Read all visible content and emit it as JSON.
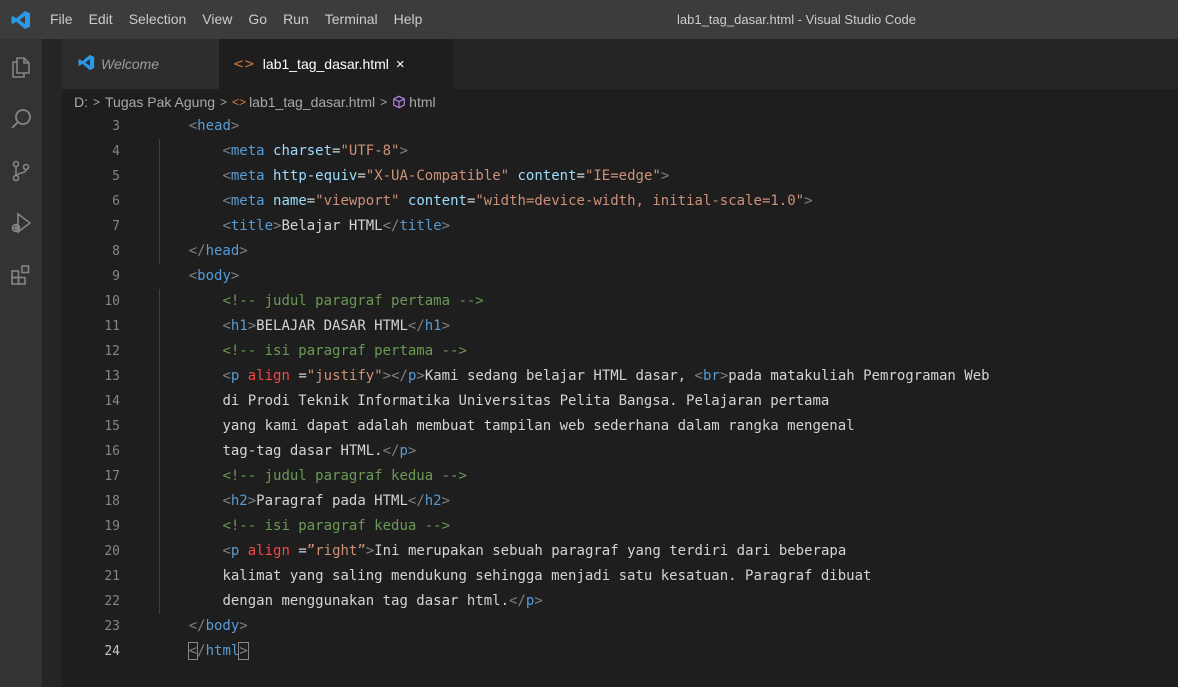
{
  "titlebar": {
    "menu": [
      "File",
      "Edit",
      "Selection",
      "View",
      "Go",
      "Run",
      "Terminal",
      "Help"
    ],
    "window_title": "lab1_tag_dasar.html - Visual Studio Code"
  },
  "activity": [
    "explorer-icon",
    "search-icon",
    "source-control-icon",
    "run-debug-icon",
    "extensions-icon"
  ],
  "tabs": [
    {
      "label": "Welcome",
      "icon": "vscode-icon",
      "active": false
    },
    {
      "label": "lab1_tag_dasar.html",
      "icon": "html-icon",
      "active": true,
      "close": "×"
    }
  ],
  "breadcrumb": {
    "drive": "D:",
    "folder": "Tugas Pak Agung",
    "file": "lab1_tag_dasar.html",
    "symbol": "html",
    "sep": ">"
  },
  "editor": {
    "current_line": 24,
    "lines": [
      {
        "num": "3",
        "tokens": [
          [
            "i",
            "    "
          ],
          [
            "br",
            "<"
          ],
          [
            "tag",
            "head"
          ],
          [
            "br",
            ">"
          ]
        ]
      },
      {
        "num": "4",
        "tokens": [
          [
            "i",
            "        "
          ],
          [
            "br",
            "<"
          ],
          [
            "tag",
            "meta"
          ],
          [
            "txt",
            " "
          ],
          [
            "attr",
            "charset"
          ],
          [
            "op",
            "="
          ],
          [
            "str",
            "\"UTF-8\""
          ],
          [
            "br",
            ">"
          ]
        ]
      },
      {
        "num": "5",
        "tokens": [
          [
            "i",
            "        "
          ],
          [
            "br",
            "<"
          ],
          [
            "tag",
            "meta"
          ],
          [
            "txt",
            " "
          ],
          [
            "attr",
            "http-equiv"
          ],
          [
            "op",
            "="
          ],
          [
            "str",
            "\"X-UA-Compatible\""
          ],
          [
            "txt",
            " "
          ],
          [
            "attr",
            "content"
          ],
          [
            "op",
            "="
          ],
          [
            "str",
            "\"IE=edge\""
          ],
          [
            "br",
            ">"
          ]
        ]
      },
      {
        "num": "6",
        "tokens": [
          [
            "i",
            "        "
          ],
          [
            "br",
            "<"
          ],
          [
            "tag",
            "meta"
          ],
          [
            "txt",
            " "
          ],
          [
            "attr",
            "name"
          ],
          [
            "op",
            "="
          ],
          [
            "str",
            "\"viewport\""
          ],
          [
            "txt",
            " "
          ],
          [
            "attr",
            "content"
          ],
          [
            "op",
            "="
          ],
          [
            "str",
            "\"width=device-width, initial-scale=1.0\""
          ],
          [
            "br",
            ">"
          ]
        ]
      },
      {
        "num": "7",
        "tokens": [
          [
            "i",
            "        "
          ],
          [
            "br",
            "<"
          ],
          [
            "tag",
            "title"
          ],
          [
            "br",
            ">"
          ],
          [
            "txt",
            "Belajar HTML"
          ],
          [
            "br",
            "</"
          ],
          [
            "tag",
            "title"
          ],
          [
            "br",
            ">"
          ]
        ]
      },
      {
        "num": "8",
        "tokens": [
          [
            "i",
            "    "
          ],
          [
            "br",
            "</"
          ],
          [
            "tag",
            "head"
          ],
          [
            "br",
            ">"
          ]
        ]
      },
      {
        "num": "9",
        "tokens": [
          [
            "i",
            "    "
          ],
          [
            "br",
            "<"
          ],
          [
            "tag",
            "body"
          ],
          [
            "br",
            ">"
          ]
        ]
      },
      {
        "num": "10",
        "tokens": [
          [
            "i",
            "        "
          ],
          [
            "com",
            "<!-- judul paragraf pertama -->"
          ]
        ]
      },
      {
        "num": "11",
        "tokens": [
          [
            "i",
            "        "
          ],
          [
            "br",
            "<"
          ],
          [
            "tag",
            "h1"
          ],
          [
            "br",
            ">"
          ],
          [
            "txt",
            "BELAJAR DASAR HTML"
          ],
          [
            "br",
            "</"
          ],
          [
            "tag",
            "h1"
          ],
          [
            "br",
            ">"
          ]
        ]
      },
      {
        "num": "12",
        "tokens": [
          [
            "i",
            "        "
          ],
          [
            "com",
            "<!-- isi paragraf pertama -->"
          ]
        ]
      },
      {
        "num": "13",
        "tokens": [
          [
            "i",
            "        "
          ],
          [
            "br",
            "<"
          ],
          [
            "tag",
            "p"
          ],
          [
            "txt",
            " "
          ],
          [
            "attrred",
            "align"
          ],
          [
            "txt",
            " "
          ],
          [
            "op",
            "="
          ],
          [
            "str",
            "\"justify\""
          ],
          [
            "br",
            ">"
          ],
          [
            "br",
            "</"
          ],
          [
            "tag",
            "p"
          ],
          [
            "br",
            ">"
          ],
          [
            "txt",
            "Kami sedang belajar HTML dasar, "
          ],
          [
            "br",
            "<"
          ],
          [
            "tag",
            "br"
          ],
          [
            "br",
            ">"
          ],
          [
            "txt",
            "pada matakuliah Pemrograman Web"
          ]
        ]
      },
      {
        "num": "14",
        "tokens": [
          [
            "i",
            "        "
          ],
          [
            "txt",
            "di Prodi Teknik Informatika Universitas Pelita Bangsa. Pelajaran pertama"
          ]
        ]
      },
      {
        "num": "15",
        "tokens": [
          [
            "i",
            "        "
          ],
          [
            "txt",
            "yang kami dapat adalah membuat tampilan web sederhana dalam rangka mengenal"
          ]
        ]
      },
      {
        "num": "16",
        "tokens": [
          [
            "i",
            "        "
          ],
          [
            "txt",
            "tag-tag dasar HTML."
          ],
          [
            "br",
            "</"
          ],
          [
            "tag",
            "p"
          ],
          [
            "br",
            ">"
          ]
        ]
      },
      {
        "num": "17",
        "tokens": [
          [
            "i",
            "        "
          ],
          [
            "com",
            "<!-- judul paragraf kedua -->"
          ]
        ]
      },
      {
        "num": "18",
        "tokens": [
          [
            "i",
            "        "
          ],
          [
            "br",
            "<"
          ],
          [
            "tag",
            "h2"
          ],
          [
            "br",
            ">"
          ],
          [
            "txt",
            "Paragraf pada HTML"
          ],
          [
            "br",
            "</"
          ],
          [
            "tag",
            "h2"
          ],
          [
            "br",
            ">"
          ]
        ]
      },
      {
        "num": "19",
        "tokens": [
          [
            "i",
            "        "
          ],
          [
            "com",
            "<!-- isi paragraf kedua -->"
          ]
        ]
      },
      {
        "num": "20",
        "tokens": [
          [
            "i",
            "        "
          ],
          [
            "br",
            "<"
          ],
          [
            "tag",
            "p"
          ],
          [
            "txt",
            " "
          ],
          [
            "attrred",
            "align"
          ],
          [
            "txt",
            " "
          ],
          [
            "op",
            "="
          ],
          [
            "str",
            "”right”"
          ],
          [
            "br",
            ">"
          ],
          [
            "txt",
            "Ini merupakan sebuah paragraf yang terdiri dari beberapa"
          ]
        ]
      },
      {
        "num": "21",
        "tokens": [
          [
            "i",
            "        "
          ],
          [
            "txt",
            "kalimat yang saling mendukung sehingga menjadi satu kesatuan. Paragraf dibuat"
          ]
        ]
      },
      {
        "num": "22",
        "tokens": [
          [
            "i",
            "        "
          ],
          [
            "txt",
            "dengan menggunakan tag dasar html."
          ],
          [
            "br",
            "</"
          ],
          [
            "tag",
            "p"
          ],
          [
            "br",
            ">"
          ]
        ]
      },
      {
        "num": "23",
        "tokens": [
          [
            "i",
            "    "
          ],
          [
            "br",
            "</"
          ],
          [
            "tag",
            "body"
          ],
          [
            "br",
            ">"
          ]
        ]
      },
      {
        "num": "24",
        "tokens": [
          [
            "i",
            "    "
          ],
          [
            "bm",
            "<"
          ],
          [
            "br",
            "/"
          ],
          [
            "tag",
            "html"
          ],
          [
            "bm",
            ">"
          ]
        ]
      }
    ]
  }
}
